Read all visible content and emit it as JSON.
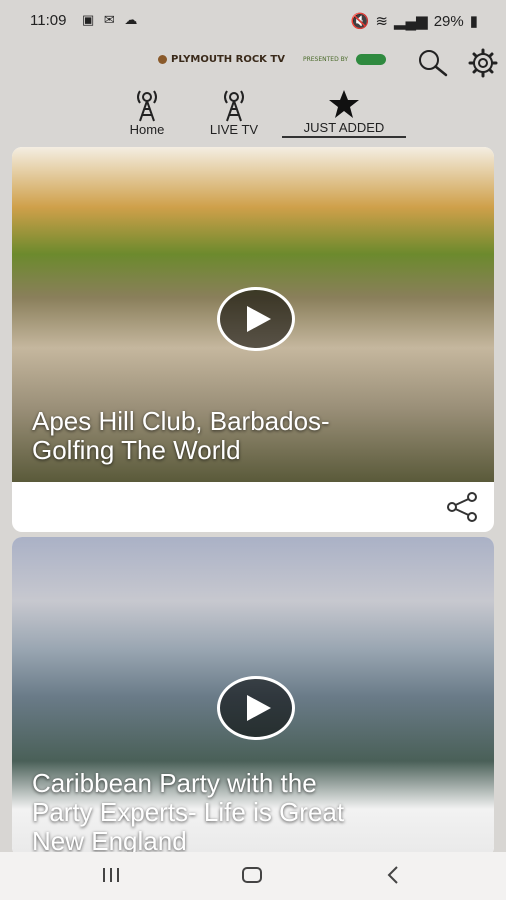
{
  "status_bar": {
    "time": "11:09",
    "battery": "29%"
  },
  "header": {
    "logo_text": "PLYMOUTH ROCK TV",
    "sponsor_text": "PRESENTED BY"
  },
  "tabs": [
    {
      "label": "Home"
    },
    {
      "label": "LIVE TV"
    },
    {
      "label": "JUST ADDED"
    }
  ],
  "videos": [
    {
      "title_line1": "Apes Hill Club, Barbados-",
      "title_line2": "Golfing The World"
    },
    {
      "title_line1": "Caribbean Party with the",
      "title_line2": "Party Experts- Life is Great",
      "title_line3": "New England"
    }
  ],
  "colors": {
    "card_bg": "#ffffff",
    "page_bg": "#d8d6d3",
    "play_overlay": "#000000",
    "caption_text": "#ffffff"
  },
  "icons": [
    "search-icon",
    "gear-icon",
    "antenna-icon",
    "star-icon",
    "play-icon",
    "share-icon"
  ]
}
